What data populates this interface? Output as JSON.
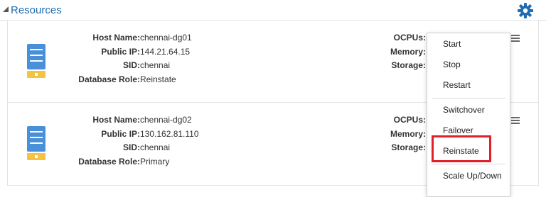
{
  "section": {
    "title": "Resources"
  },
  "colors": {
    "accent": "#1f6db1",
    "highlight": "#e0202a",
    "db_icon": "#4a90d9",
    "db_icon_base": "#f5c242"
  },
  "resources": [
    {
      "host_label": "Host Name:",
      "host_value": "chennai-dg01",
      "ip_label": "Public IP:",
      "ip_value": "144.21.64.15",
      "sid_label": "SID:",
      "sid_value": "chennai",
      "role_label": "Database Role:",
      "role_value": "Reinstate",
      "ocpus_label": "OCPUs:",
      "memory_label": "Memory:",
      "storage_label": "Storage:"
    },
    {
      "host_label": "Host Name:",
      "host_value": "chennai-dg02",
      "ip_label": "Public IP:",
      "ip_value": "130.162.81.110",
      "sid_label": "SID:",
      "sid_value": "chennai",
      "role_label": "Database Role:",
      "role_value": "Primary",
      "ocpus_label": "OCPUs:",
      "memory_label": "Memory:",
      "storage_label": "Storage:"
    }
  ],
  "menu": {
    "items": [
      "Start",
      "Stop",
      "Restart",
      "Switchover",
      "Failover",
      "Reinstate",
      "Scale Up/Down"
    ]
  }
}
